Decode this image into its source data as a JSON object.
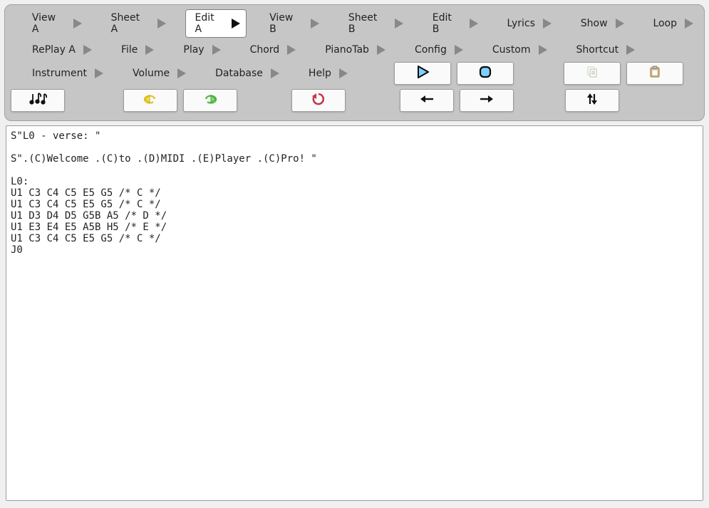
{
  "menus": {
    "row1": [
      "View A",
      "Sheet A",
      "Edit A",
      "View B",
      "Sheet B",
      "Edit B",
      "Lyrics",
      "Show",
      "Loop"
    ],
    "row2": [
      "RePlay A",
      "File",
      "Play",
      "Chord",
      "PianoTab",
      "Config",
      "Custom",
      "Shortcut"
    ],
    "row3": [
      "Instrument",
      "Volume",
      "Database",
      "Help"
    ],
    "active": "Edit A"
  },
  "editor_content": "S\"L0 - verse: \"\n\nS\".(C)Welcome .(C)to .(D)MIDI .(E)Player .(C)Pro! \"\n\nL0:\nU1 C3 C4 C5 E5 G5 /* C */\nU1 C3 C4 C5 E5 G5 /* C */\nU1 D3 D4 D5 G5B A5 /* D */\nU1 E3 E4 E5 A5B H5 /* E */\nU1 C3 C4 C5 E5 G5 /* C */\nJ0"
}
